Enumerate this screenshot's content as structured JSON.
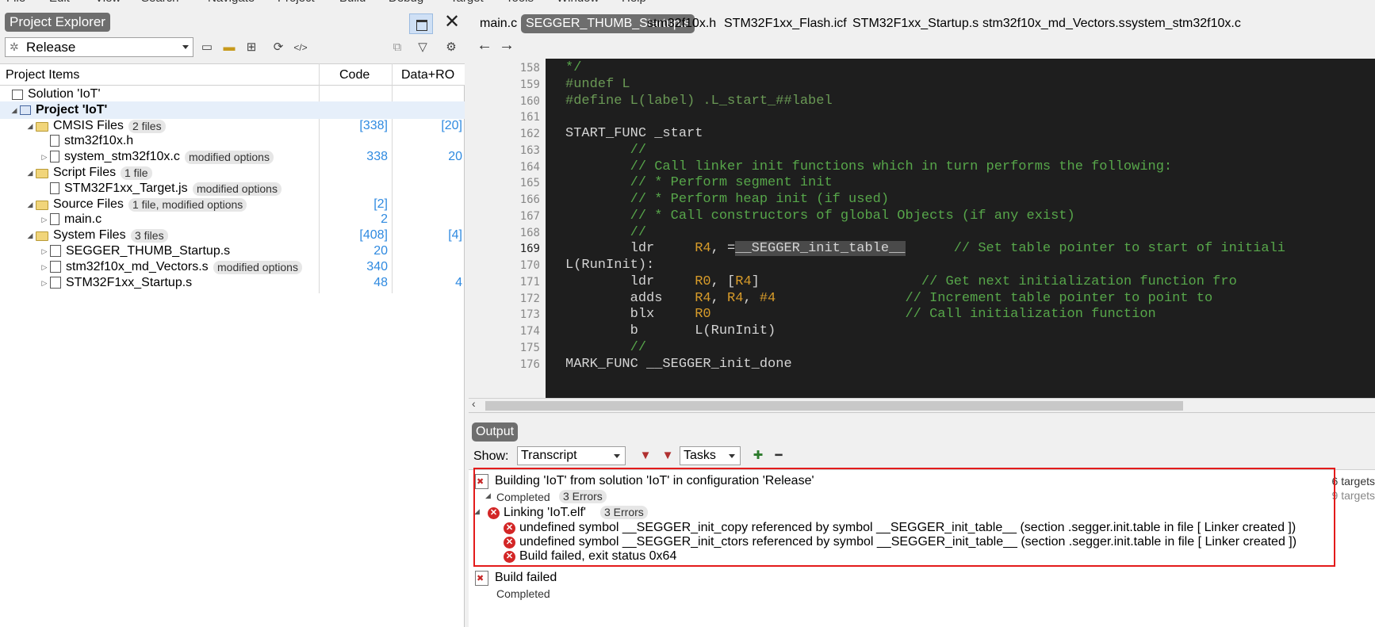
{
  "project_explorer": {
    "title": "Project Explorer",
    "config": "Release",
    "columns": {
      "items": "Project Items",
      "code": "Code",
      "dataro": "Data+RO"
    },
    "tree": [
      {
        "type": "sol",
        "label": "Solution 'IoT'",
        "badge": "",
        "code": "",
        "dataro": "",
        "indent": 0,
        "expander": ""
      },
      {
        "type": "proj",
        "label": "Project 'IoT'",
        "badge": "",
        "code": "",
        "dataro": "",
        "indent": 1,
        "expander": "◢",
        "bold": true,
        "selected": true
      },
      {
        "type": "folder",
        "label": "CMSIS Files",
        "badge": "2 files",
        "code": "[338]",
        "dataro": "[20]",
        "indent": 2,
        "expander": "◢"
      },
      {
        "type": "doc",
        "label": "stm32f10x.h",
        "badge": "",
        "code": "",
        "dataro": "",
        "indent": 3,
        "expander": ""
      },
      {
        "type": "doc",
        "label": "system_stm32f10x.c",
        "badge": "modified options",
        "code": "338",
        "dataro": "20",
        "indent": 3,
        "expander": "▷"
      },
      {
        "type": "folder",
        "label": "Script Files",
        "badge": "1 file",
        "code": "",
        "dataro": "",
        "indent": 2,
        "expander": "◢"
      },
      {
        "type": "doc",
        "label": "STM32F1xx_Target.js",
        "badge": "modified options",
        "code": "",
        "dataro": "",
        "indent": 3,
        "expander": ""
      },
      {
        "type": "folder",
        "label": "Source Files",
        "badge": "1 file, modified options",
        "code": "[2]",
        "dataro": "",
        "indent": 2,
        "expander": "◢"
      },
      {
        "type": "doc",
        "label": "main.c",
        "badge": "",
        "code": "2",
        "dataro": "",
        "indent": 3,
        "expander": "▷"
      },
      {
        "type": "folder",
        "label": "System Files",
        "badge": "3 files",
        "code": "[408]",
        "dataro": "[4]",
        "indent": 2,
        "expander": "◢"
      },
      {
        "type": "asm",
        "label": "SEGGER_THUMB_Startup.s",
        "badge": "",
        "code": "20",
        "dataro": "",
        "indent": 3,
        "expander": "▷"
      },
      {
        "type": "asm",
        "label": "stm32f10x_md_Vectors.s",
        "badge": "modified options",
        "code": "340",
        "dataro": "",
        "indent": 3,
        "expander": "▷"
      },
      {
        "type": "asm",
        "label": "STM32F1xx_Startup.s",
        "badge": "",
        "code": "48",
        "dataro": "4",
        "indent": 3,
        "expander": "▷"
      }
    ]
  },
  "editor": {
    "tabs": [
      {
        "label": "main.c",
        "active": false
      },
      {
        "label": "SEGGER_THUMB_Startup.s",
        "active": true
      },
      {
        "label": "stm32f10x.h",
        "active": false
      },
      {
        "label": "STM32F1xx_Flash.icf",
        "active": false
      },
      {
        "label": "STM32F1xx_Startup.s",
        "active": false
      },
      {
        "label": "stm32f10x_md_Vectors.s",
        "active": false
      },
      {
        "label": "system_stm32f10x.c",
        "active": false
      }
    ],
    "current_line": "169",
    "lines": [
      {
        "n": "158",
        "segs": [
          [
            "c-com",
            "*/"
          ]
        ]
      },
      {
        "n": "159",
        "segs": [
          [
            "c-pp",
            "#undef L"
          ]
        ]
      },
      {
        "n": "160",
        "segs": [
          [
            "c-pp",
            "#define L(label) .L_start_##label"
          ]
        ]
      },
      {
        "n": "161",
        "segs": []
      },
      {
        "n": "162",
        "segs": [
          [
            "",
            "START_FUNC _start"
          ]
        ]
      },
      {
        "n": "163",
        "segs": [
          [
            "c-com",
            "        //"
          ]
        ]
      },
      {
        "n": "164",
        "segs": [
          [
            "c-com",
            "        // Call linker init functions which in turn performs the following:"
          ]
        ]
      },
      {
        "n": "165",
        "segs": [
          [
            "c-com",
            "        // * Perform segment init"
          ]
        ]
      },
      {
        "n": "166",
        "segs": [
          [
            "c-com",
            "        // * Perform heap init (if used)"
          ]
        ]
      },
      {
        "n": "167",
        "segs": [
          [
            "c-com",
            "        // * Call constructors of global Objects (if any exist)"
          ]
        ]
      },
      {
        "n": "168",
        "segs": [
          [
            "c-com",
            "        //"
          ]
        ]
      },
      {
        "n": "169",
        "segs": [
          [
            "",
            "        ldr     "
          ],
          [
            "c-reg",
            "R4"
          ],
          [
            "",
            ", ="
          ],
          [
            "c-hl",
            "__SEGGER_init_table__"
          ],
          [
            "",
            "      "
          ],
          [
            "c-com",
            "// Set table pointer to start of initiali"
          ]
        ]
      },
      {
        "n": "170",
        "segs": [
          [
            "",
            "L(RunInit):"
          ]
        ]
      },
      {
        "n": "171",
        "segs": [
          [
            "",
            "        ldr     "
          ],
          [
            "c-reg",
            "R0"
          ],
          [
            "",
            ", ["
          ],
          [
            "c-reg",
            "R4"
          ],
          [
            "",
            "]                    "
          ],
          [
            "c-com",
            "// Get next initialization function fro"
          ]
        ]
      },
      {
        "n": "172",
        "segs": [
          [
            "",
            "        adds    "
          ],
          [
            "c-reg",
            "R4"
          ],
          [
            "",
            ", "
          ],
          [
            "c-reg",
            "R4"
          ],
          [
            "",
            ", "
          ],
          [
            "c-reg",
            "#4"
          ],
          [
            "",
            "                "
          ],
          [
            "c-com",
            "// Increment table pointer to point to"
          ]
        ]
      },
      {
        "n": "173",
        "segs": [
          [
            "",
            "        blx     "
          ],
          [
            "c-reg",
            "R0"
          ],
          [
            "",
            "                        "
          ],
          [
            "c-com",
            "// Call initialization function"
          ]
        ]
      },
      {
        "n": "174",
        "segs": [
          [
            "",
            "        b       L(RunInit)"
          ]
        ]
      },
      {
        "n": "175",
        "segs": [
          [
            "c-com",
            "        //"
          ]
        ]
      },
      {
        "n": "176",
        "segs": [
          [
            "",
            "MARK_FUNC __SEGGER_init_done"
          ]
        ]
      }
    ]
  },
  "output": {
    "title": "Output",
    "show_label": "Show:",
    "show_value": "Transcript",
    "tasks_value": "Tasks",
    "build_line": "Building 'IoT' from solution 'IoT' in configuration 'Release'",
    "build_status": "Completed",
    "build_errors": "3 Errors",
    "link_line": "Linking 'IoT.elf'",
    "link_errors": "3 Errors",
    "errors": [
      "undefined symbol __SEGGER_init_copy referenced by symbol __SEGGER_init_table__ (section .segger.init.table in file [ Linker created ])",
      "undefined symbol __SEGGER_init_ctors referenced by symbol __SEGGER_init_table__ (section .segger.init.table in file [ Linker created ])",
      "Build failed, exit status 0x64"
    ],
    "right_cut_1": "6 targets",
    "right_cut_2": "9 targets",
    "failed_line": "Build failed",
    "failed_status": "Completed"
  },
  "colors": {
    "highlight_border": "#e31b1b",
    "link_blue": "#2f8ae0",
    "code_bg": "#1e1e1e"
  }
}
